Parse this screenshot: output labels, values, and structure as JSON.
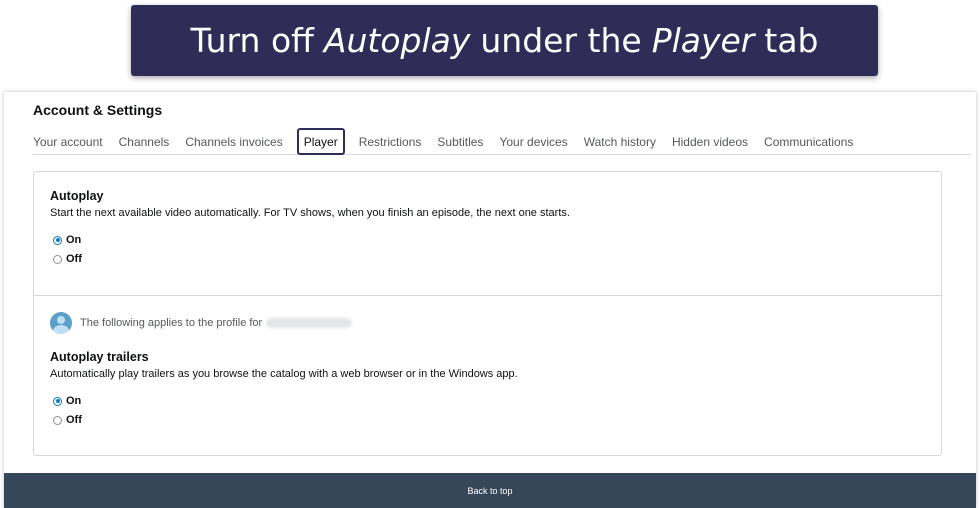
{
  "banner": {
    "part1": "Turn off",
    "part2": "Autoplay",
    "part3": "under the",
    "part4": "Player",
    "part5": "tab"
  },
  "page_title": "Account & Settings",
  "tabs": [
    {
      "label": "Your account"
    },
    {
      "label": "Channels"
    },
    {
      "label": "Channels invoices"
    },
    {
      "label": "Player",
      "active": true
    },
    {
      "label": "Restrictions"
    },
    {
      "label": "Subtitles"
    },
    {
      "label": "Your devices"
    },
    {
      "label": "Watch history"
    },
    {
      "label": "Hidden videos"
    },
    {
      "label": "Communications"
    }
  ],
  "autoplay": {
    "title": "Autoplay",
    "description": "Start the next available video automatically. For TV shows, when you finish an episode, the next one starts.",
    "options": [
      {
        "label": "On",
        "selected": true
      },
      {
        "label": "Off",
        "selected": false
      }
    ]
  },
  "profile": {
    "text": "The following applies to the profile for"
  },
  "autoplay_trailers": {
    "title": "Autoplay trailers",
    "description": "Automatically play trailers as you browse the catalog with a web browser or in the Windows app.",
    "options": [
      {
        "label": "On",
        "selected": true
      },
      {
        "label": "Off",
        "selected": false
      }
    ]
  },
  "footer": {
    "back_to_top": "Back to top"
  },
  "colors": {
    "banner_bg": "#2f2d57",
    "radio_accent": "#0a7bc4",
    "footer_bg": "#37475a"
  }
}
